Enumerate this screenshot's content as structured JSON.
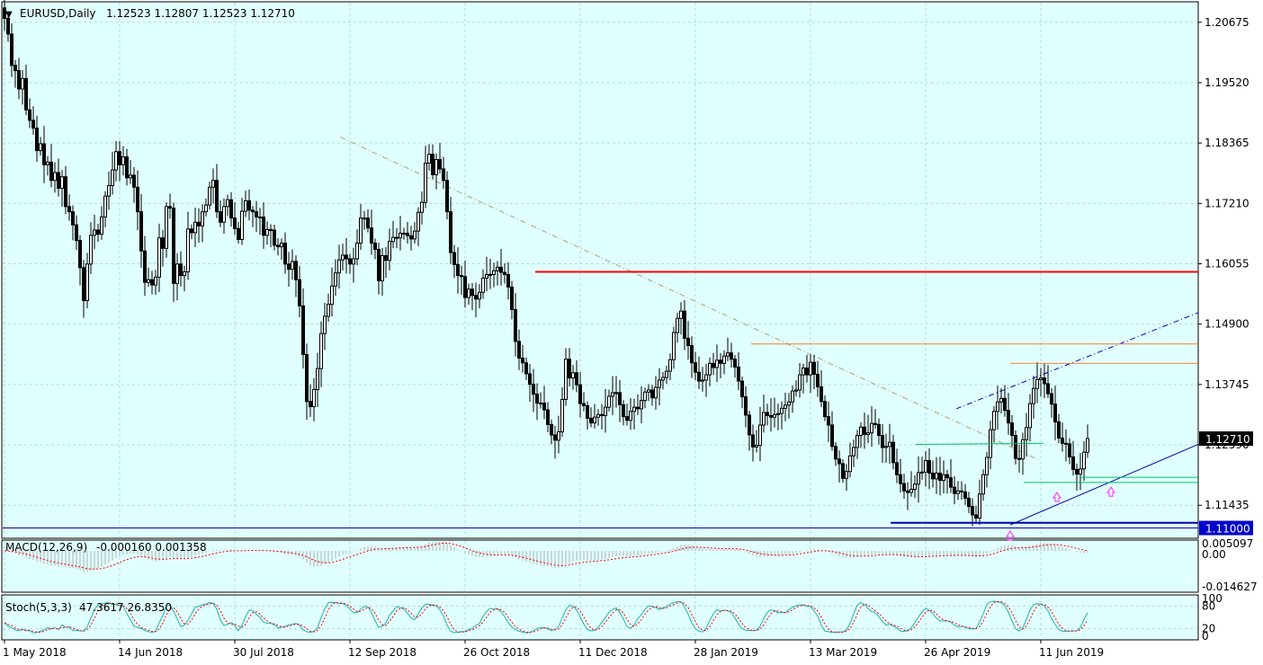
{
  "header": {
    "symbol_tf": "EURUSD,Daily",
    "ohlc": "1.12523 1.12807 1.12523 1.12710"
  },
  "colors": {
    "background": "#e0ffff",
    "grid": "#b7d9d9",
    "candle": "#000000",
    "resistance_red": "#ff0000",
    "resistance_orange": "#ff7f27",
    "trend_blue": "#0000aa",
    "trend_dashdot_blue": "#0000cc",
    "downtrend_tan": "#b4a06e",
    "support_green": "#00c060",
    "support_line": "#0000cc",
    "arrow_magenta": "#ff44ff",
    "macd_hist": "#b0b0b0",
    "macd_signal": "#ff0000",
    "stoch_main": "#20b2aa",
    "stoch_signal": "#ff0000"
  },
  "chart_data": {
    "type": "candlestick",
    "symbol": "EURUSD",
    "timeframe": "Daily",
    "price_axis_labels": [
      "1.20675",
      "1.19520",
      "1.18365",
      "1.17210",
      "1.16055",
      "1.14900",
      "1.13745",
      "1.12590",
      "1.11435"
    ],
    "price_axis_values": [
      1.20675,
      1.1952,
      1.18365,
      1.1721,
      1.16055,
      1.149,
      1.13745,
      1.1259,
      1.11435
    ],
    "ylim": [
      1.1082,
      1.2105
    ],
    "date_labels": [
      "1 May 2018",
      "14 Jun 2018",
      "30 Jul 2018",
      "12 Sep 2018",
      "26 Oct 2018",
      "11 Dec 2018",
      "28 Jan 2019",
      "13 Mar 2019",
      "26 Apr 2019",
      "11 Jun 2019"
    ],
    "current_price": "1.12710",
    "support_level_label": "1.11000",
    "closes": [
      1.2075,
      1.2045,
      1.1985,
      1.1975,
      1.194,
      1.196,
      1.19,
      1.188,
      1.1865,
      1.1822,
      1.1835,
      1.1795,
      1.18,
      1.1765,
      1.178,
      1.175,
      1.1772,
      1.1715,
      1.1705,
      1.168,
      1.165,
      1.1598,
      1.1535,
      1.1605,
      1.166,
      1.167,
      1.1662,
      1.1695,
      1.1735,
      1.1755,
      1.1785,
      1.182,
      1.1795,
      1.181,
      1.177,
      1.1775,
      1.1752,
      1.1705,
      1.163,
      1.157,
      1.1575,
      1.1565,
      1.158,
      1.1655,
      1.1635,
      1.1715,
      1.1712,
      1.1568,
      1.1605,
      1.1583,
      1.159,
      1.1672,
      1.1665,
      1.1685,
      1.1678,
      1.1705,
      1.1718,
      1.1752,
      1.1765,
      1.1705,
      1.1685,
      1.1715,
      1.1728,
      1.1693,
      1.1673,
      1.1652,
      1.1706,
      1.1726,
      1.1708,
      1.1705,
      1.1695,
      1.1695,
      1.166,
      1.1671,
      1.167,
      1.1641,
      1.1638,
      1.1645,
      1.1605,
      1.1595,
      1.161,
      1.1575,
      1.1525,
      1.1432,
      1.1342,
      1.1332,
      1.1365,
      1.1405,
      1.1472,
      1.1505,
      1.1528,
      1.1563,
      1.1588,
      1.1613,
      1.1622,
      1.1615,
      1.1605,
      1.1615,
      1.1645,
      1.1693,
      1.1693,
      1.1674,
      1.1645,
      1.1633,
      1.1573,
      1.1621,
      1.1612,
      1.1648,
      1.1656,
      1.1655,
      1.1664,
      1.1664,
      1.1659,
      1.1653,
      1.1668,
      1.1704,
      1.1723,
      1.1798,
      1.1815,
      1.1776,
      1.1805,
      1.1787,
      1.1765,
      1.1705,
      1.1627,
      1.1604,
      1.1583,
      1.1581,
      1.1541,
      1.1557,
      1.1545,
      1.1538,
      1.1551,
      1.1578,
      1.1585,
      1.1585,
      1.1592,
      1.1599,
      1.1589,
      1.1585,
      1.1561,
      1.1518,
      1.1457,
      1.1425,
      1.1416,
      1.1395,
      1.1375,
      1.1356,
      1.1339,
      1.1339,
      1.1326,
      1.1298,
      1.1278,
      1.1268,
      1.1284,
      1.1346,
      1.1423,
      1.1387,
      1.1397,
      1.1374,
      1.1338,
      1.1334,
      1.131,
      1.1301,
      1.1312,
      1.1317,
      1.1315,
      1.1331,
      1.1352,
      1.1359,
      1.1359,
      1.1336,
      1.1313,
      1.1306,
      1.1323,
      1.1331,
      1.1328,
      1.1344,
      1.136,
      1.1364,
      1.1349,
      1.1369,
      1.1383,
      1.1388,
      1.14,
      1.1422,
      1.1474,
      1.1501,
      1.1515,
      1.1463,
      1.1449,
      1.1416,
      1.1398,
      1.1381,
      1.1383,
      1.1393,
      1.1415,
      1.1407,
      1.1421,
      1.1415,
      1.1429,
      1.1435,
      1.1423,
      1.1408,
      1.1381,
      1.1351,
      1.1316,
      1.1278,
      1.1255,
      1.1258,
      1.1297,
      1.1321,
      1.1315,
      1.1312,
      1.1317,
      1.1319,
      1.1329,
      1.1335,
      1.1341,
      1.1362,
      1.1364,
      1.1393,
      1.1406,
      1.1393,
      1.1417,
      1.1394,
      1.137,
      1.1342,
      1.1313,
      1.1297,
      1.1256,
      1.1232,
      1.1223,
      1.1195,
      1.1208,
      1.1238,
      1.1254,
      1.1277,
      1.1293,
      1.1279,
      1.1282,
      1.13,
      1.1298,
      1.1277,
      1.1254,
      1.1256,
      1.1264,
      1.1225,
      1.1202,
      1.1185,
      1.1171,
      1.1168,
      1.1174,
      1.1184,
      1.1206,
      1.1207,
      1.1229,
      1.1205,
      1.1194,
      1.1205,
      1.1191,
      1.1202,
      1.1196,
      1.1178,
      1.1166,
      1.1171,
      1.1169,
      1.1157,
      1.1141,
      1.1125,
      1.1119,
      1.1165,
      1.1202,
      1.1235,
      1.1288,
      1.1323,
      1.1341,
      1.1348,
      1.1325,
      1.1301,
      1.1277,
      1.1233,
      1.1232,
      1.1269,
      1.1292,
      1.1338,
      1.1367,
      1.1384,
      1.1387,
      1.1376,
      1.1357,
      1.1337,
      1.1303,
      1.1272,
      1.1262,
      1.1261,
      1.1236,
      1.1212,
      1.1203,
      1.1213,
      1.1245,
      1.1271
    ],
    "macd_label": "MACD(12,26,9)",
    "macd_values": "-0.000160 0.001358",
    "macd_axis_labels": [
      "0.005097",
      "0.00",
      "-0.014627"
    ],
    "stoch_label": "Stoch(5,3,3)",
    "stoch_values": "47.3617 26.8350",
    "stoch_axis_labels": [
      "100",
      "80",
      "20",
      "0"
    ]
  }
}
